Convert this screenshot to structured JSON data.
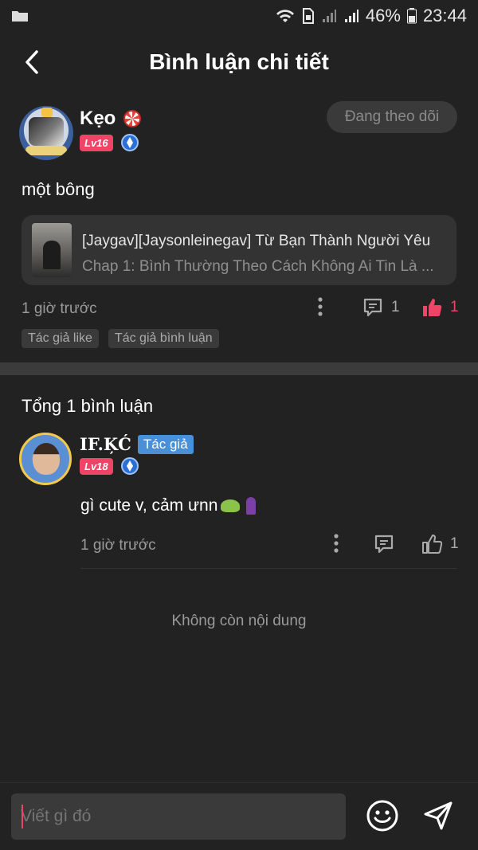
{
  "status_bar": {
    "battery": "46%",
    "time": "23:44"
  },
  "header": {
    "title": "Bình luận chi tiết"
  },
  "post": {
    "username": "Kẹo",
    "level": "Lv16",
    "follow_label": "Đang theo dõi",
    "text": "một bông",
    "story": {
      "title": "[Jaygav][Jaysonleinegav] Từ Bạn Thành Người Yêu",
      "chapter": "Chap 1: Bình Thường Theo Cách Không Ai Tin Là ..."
    },
    "time": "1 giờ trước",
    "comment_count": "1",
    "like_count": "1",
    "chips": [
      "Tác giả like",
      "Tác giả bình luận"
    ]
  },
  "comments_section": {
    "total_label": "Tổng 1 bình luận",
    "comments": [
      {
        "username": "IF.ĶĆ",
        "author_tag": "Tác giả",
        "level": "Lv18",
        "text": "gì cute v, cảm ưnn",
        "time": "1 giờ trước",
        "like_count": "1"
      }
    ],
    "end_label": "Không còn nội dung"
  },
  "composer": {
    "placeholder": "Viết gì đó"
  },
  "colors": {
    "accent": "#ee4466",
    "author_tag": "#4a90d9",
    "background": "#222222"
  }
}
